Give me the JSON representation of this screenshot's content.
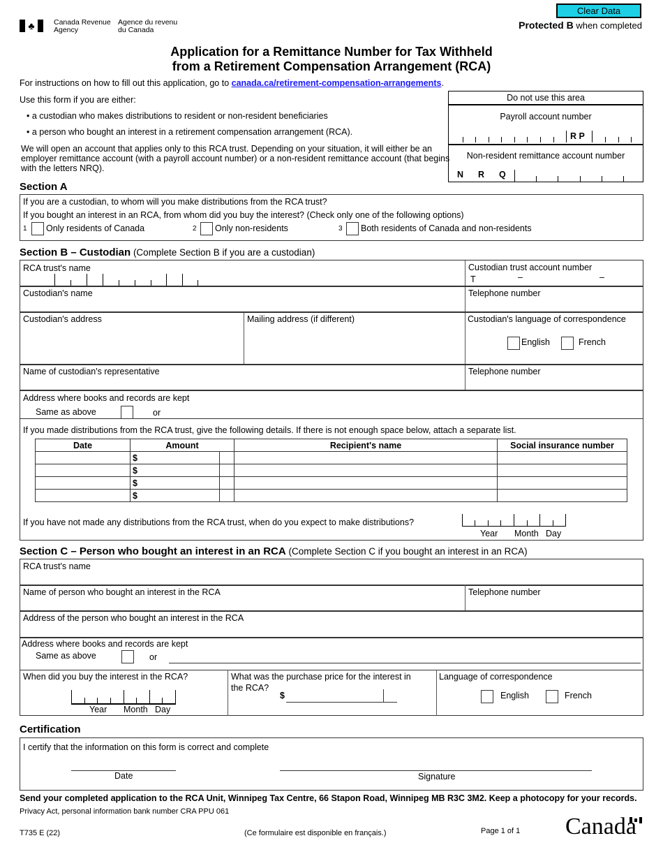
{
  "header": {
    "agency_en_1": "Canada Revenue",
    "agency_en_2": "Agency",
    "agency_fr_1": "Agence du revenu",
    "agency_fr_2": "du Canada",
    "clear_button": "Clear Data",
    "protected_bold": "Protected B",
    "protected_rest": " when completed",
    "title_line1": "Application for a Remittance Number for Tax Withheld",
    "title_line2": "from a Retirement Compensation Arrangement (RCA)"
  },
  "intro": {
    "instructions_prefix": "For instructions on how to fill out this application, go to ",
    "instructions_link": "canada.ca/retirement-compensation-arrangements",
    "instructions_suffix": ".",
    "use_form": "Use this form if you are either:",
    "bullet1": "•  a custodian who makes distributions to resident or non-resident beneficiaries",
    "bullet2": "•  a person who bought an interest in a retirement compensation arrangement (RCA).",
    "paragraph": "We will open an account that applies only to this RCA trust. Depending on your situation, it will either be an employer remittance account (with a payroll account number) or a non-resident remittance account (that begins with the letters NRQ)."
  },
  "do_not_use": {
    "heading": "Do not use this area",
    "payroll_label": "Payroll account number",
    "payroll_letters": "R  P",
    "nonres_label": "Non-resident remittance account number",
    "nrq_n": "N",
    "nrq_r": "R",
    "nrq_q": "Q"
  },
  "section_a": {
    "title": "Section A",
    "q1": "If you are a custodian, to whom will you make distributions from the RCA trust?",
    "q2": "If you bought an interest in an RCA, from whom did you buy the interest? (Check only one of the following options)",
    "options": [
      {
        "num": "1",
        "label": "Only residents of Canada"
      },
      {
        "num": "2",
        "label": "Only non-residents"
      },
      {
        "num": "3",
        "label": "Both residents of Canada and non-residents"
      }
    ]
  },
  "section_b": {
    "title": "Section B – Custodian",
    "note": " (Complete Section B if you are a custodian)",
    "rca_trust_name": "RCA trust's name",
    "trust_account_label": "Custodian trust account number",
    "trust_account_prefix": "T",
    "dash": "–",
    "custodian_name": "Custodian's name",
    "telephone": "Telephone number",
    "custodian_address": "Custodian's address",
    "mailing_address": "Mailing address (if different)",
    "language_label": "Custodian's language of correspondence",
    "english": "English",
    "french": "French",
    "representative": "Name of custodian's representative",
    "telephone2": "Telephone number",
    "books_label": "Address where books and records are kept",
    "same_as_above": "Same as above",
    "or": "or",
    "distributions_intro": "If you made distributions from the RCA trust, give the following details. If there is not enough space below, attach a separate list.",
    "table_headers": [
      "Date",
      "Amount",
      "Recipient's name",
      "Social insurance number"
    ],
    "currency": "$",
    "rows": 4,
    "no_distributions_q": "If you have not made any distributions from the RCA trust, when do you expect to make distributions?",
    "year": "Year",
    "month": "Month",
    "day": "Day"
  },
  "section_c": {
    "title": "Section C – Person who bought an interest in an RCA",
    "note": " (Complete Section C if you bought an interest in an RCA)",
    "rca_trust_name": "RCA trust's name",
    "person_name": "Name of person who bought an interest in the RCA",
    "telephone": "Telephone number",
    "person_address": "Address of the person who bought an interest in the RCA",
    "books_label": "Address where books and records are kept",
    "same_as_above": "Same as above",
    "or": "or",
    "when_bought": "When did you buy the interest in the RCA?",
    "year": "Year",
    "month": "Month",
    "day": "Day",
    "purchase_price_1": "What was the purchase price for the interest in",
    "purchase_price_2": "the RCA?",
    "currency": "$",
    "language_label": "Language of correspondence",
    "english": "English",
    "french": "French"
  },
  "certification": {
    "title": "Certification",
    "statement": "I certify that the information on this form is correct and complete",
    "date": "Date",
    "signature": "Signature"
  },
  "footer": {
    "send_to": "Send your completed application to the RCA Unit, Winnipeg Tax Centre, 66 Stapon Road, Winnipeg MB  R3C 3M2. Keep a photocopy for your records.",
    "privacy": "Privacy Act, personal information bank number CRA PPU 061",
    "form_code": "T735 E (22)",
    "french_available": "(Ce formulaire est disponible en français.)",
    "page": "Page 1 of 1",
    "wordmark": "Canada"
  }
}
